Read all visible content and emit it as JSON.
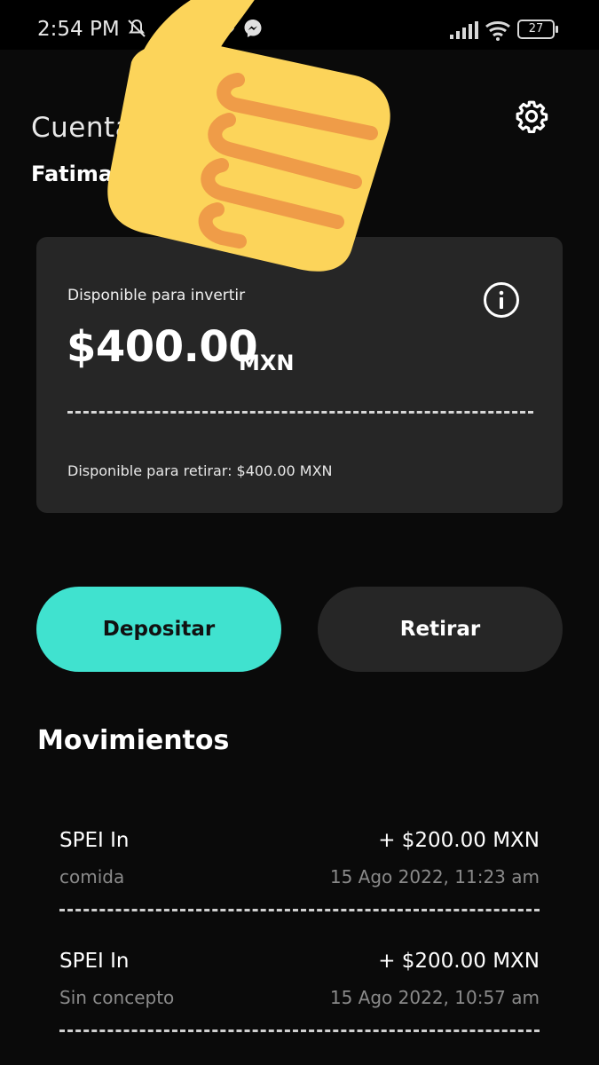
{
  "status_bar": {
    "time": "2:54 PM",
    "battery": "27",
    "icons": [
      "muted-bell-icon",
      "eye-icon",
      "messenger-icon",
      "signal-icon",
      "wifi-icon",
      "battery-icon"
    ]
  },
  "header": {
    "title": "Cuenta",
    "user_name": "Fatima",
    "settings_icon": "gear-icon"
  },
  "balance_card": {
    "label": "Disponible para invertir",
    "amount": "$400.00",
    "currency": "MXN",
    "info_icon": "info-icon",
    "withdraw_available": "Disponible para retirar: $400.00 MXN"
  },
  "actions": {
    "deposit_label": "Depositar",
    "withdraw_label": "Retirar"
  },
  "movements": {
    "title": "Movimientos",
    "items": [
      {
        "type": "SPEI In",
        "amount": "+ $200.00 MXN",
        "concept": "comida",
        "date": "15 Ago 2022, 11:23 am"
      },
      {
        "type": "SPEI In",
        "amount": "+ $200.00 MXN",
        "concept": "Sin concepto",
        "date": "15 Ago 2022, 10:57 am"
      }
    ]
  },
  "overlay": {
    "icon": "thumbs-up-emoji-icon"
  },
  "colors": {
    "background": "#0a0a0a",
    "card": "#262626",
    "accent": "#40e2cf",
    "muted_text": "#8a8a8a"
  }
}
